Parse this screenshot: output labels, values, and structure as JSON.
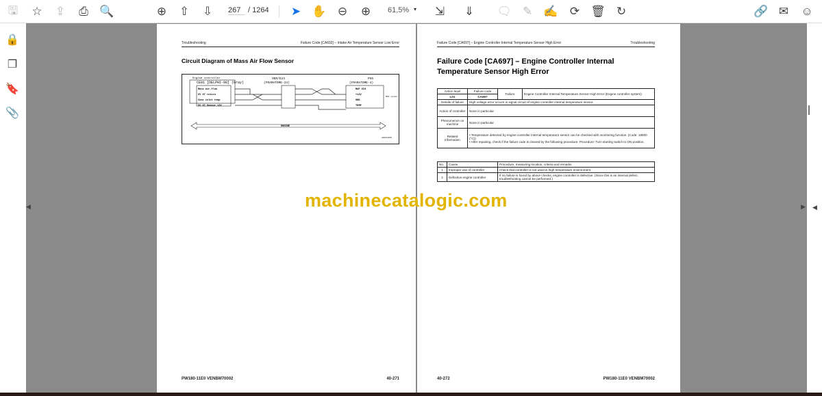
{
  "toolbar": {
    "page_current": "267",
    "page_total": "/ 1264",
    "zoom": "61,5%"
  },
  "left_page": {
    "header_left": "Troubleshooting",
    "header_right": "Failure Code [CA692] – Intake Air Temperature Sensor Low Error",
    "title": "Circuit Diagram of Mass Air Flow Sensor",
    "diagram": {
      "controller_label": "Engine controller",
      "ce01": "CE01 [DELPHI-98] (Gray)",
      "pins": [
        "Mass air-flow",
        "5V 07 return",
        "Case inlet temp",
        "5V 07 Sensor 12V"
      ],
      "pin_nums": [
        "16",
        "66",
        "81",
        "65"
      ],
      "e24": "OEM/E24",
      "e24_type": "(FRAMATOME-24)",
      "e24_pins": [
        "2",
        "3",
        "1",
        "15"
      ],
      "p55": "P55",
      "p55_type": "(FRAMATOME-4)",
      "p55_pins": [
        "1",
        "2",
        "3",
        "4"
      ],
      "p55_labels": [
        "MAF SIG",
        "+12V",
        "GND",
        "TEMP"
      ],
      "sensor": "MAF sensor",
      "engine": "ENGINE",
      "ref": "e00874815"
    },
    "footer_left": "PW180-11E0   VENBM70002",
    "footer_right": "40-271"
  },
  "right_page": {
    "header_left": "Failure Code [CA697] – Engine Controller Internal Temperature Sensor High Error",
    "header_right": "Troubleshooting",
    "title": "Failure Code [CA697] – Engine Controller Internal Temperature Sensor High Error",
    "info": {
      "action_level_label": "Action level",
      "action_level": "L01",
      "failure_code_label": "Failure code",
      "failure_code": "CA697",
      "failure_label": "Failure",
      "failure_text": "Engine Controller Internal Temperature Sensor High Error (Engine controller system)",
      "details_label": "Details of failure",
      "details": "High voltage error occurs in signal circuit of engine controller internal temperature sensor.",
      "action_label": "Action of controller",
      "action": "None in particular",
      "phenomenon_label": "Phenomenon on machine",
      "phenomenon": "None in particular",
      "related_label": "Related information",
      "related": [
        "Temperature detected by engine controller internal temperature sensor can be checked with monitoring function. (Code: 18900 (°C))",
        "After repairing, check if the failure code is cleared by the following procedure. Procedure: Turn starting switch to ON position."
      ]
    },
    "causes": {
      "headers": [
        "No.",
        "Cause",
        "Procedure, measuring location, criteria and remarks"
      ],
      "rows": [
        [
          "1",
          "Improper use of controller",
          "Check that controller is not used in high temperature environment."
        ],
        [
          "2",
          "Defective engine controller",
          "If no failure is found by above checks, engine controller is defective. (Since this is an internal defect, troubleshooting cannot be performed.)"
        ]
      ]
    },
    "footer_left": "40-272",
    "footer_right": "PW180-11E0   VENBM70002"
  },
  "watermark": "machinecatalogic.com"
}
